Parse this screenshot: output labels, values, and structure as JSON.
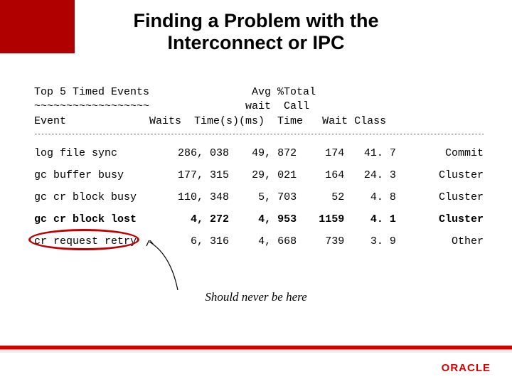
{
  "title_line1": "Finding a Problem with the",
  "title_line2": "Interconnect or IPC",
  "header": {
    "l1": "Top 5 Timed Events                Avg %Total",
    "l2": "~~~~~~~~~~~~~~~~~~               wait  Call",
    "l3": "Event             Waits  Time(s)(ms)  Time   Wait Class"
  },
  "chart_data": {
    "type": "table",
    "title": "Top 5 Timed Events",
    "columns": [
      "Event",
      "Waits",
      "Time(s)",
      "Avg wait (ms)",
      "%Total Call Time",
      "Wait Class"
    ],
    "rows": [
      {
        "event": "log file sync",
        "waits": "286, 038",
        "times": "49, 872",
        "ms": "174",
        "pct": "41. 7",
        "class": "Commit",
        "highlight": false
      },
      {
        "event": "gc buffer busy",
        "waits": "177, 315",
        "times": "29, 021",
        "ms": "164",
        "pct": "24. 3",
        "class": "Cluster",
        "highlight": false
      },
      {
        "event": "gc cr block busy",
        "waits": "110, 348",
        "times": "5, 703",
        "ms": "52",
        "pct": "4. 8",
        "class": "Cluster",
        "highlight": false
      },
      {
        "event": "gc cr block lost",
        "waits": "4, 272",
        "times": "4, 953",
        "ms": "1159",
        "pct": "4. 1",
        "class": "Cluster",
        "highlight": true
      },
      {
        "event": "cr request retry",
        "waits": "6, 316",
        "times": "4, 668",
        "ms": "739",
        "pct": "3. 9",
        "class": "Other",
        "highlight": false
      }
    ]
  },
  "annotation": "Should never be here",
  "logo": "ORACLE",
  "colors": {
    "brand_red": "#c00000"
  }
}
